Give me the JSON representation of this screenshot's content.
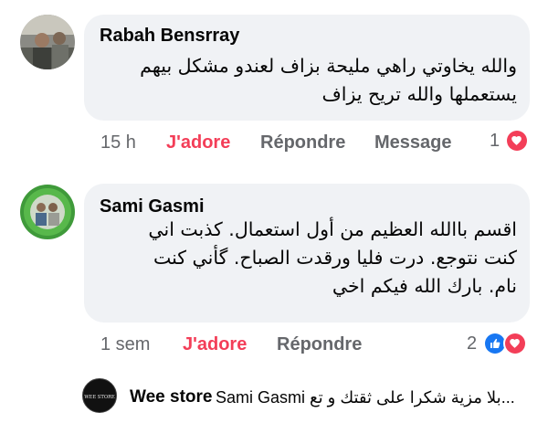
{
  "comments": [
    {
      "author": "Rabah Bensrray",
      "text_lines": [
        "والله يخاوتي راهي مليحة بزاف لعندو مشكل بيهم",
        "يستعملها والله تريح يزاف"
      ],
      "time": "15 h",
      "like_label": "J'adore",
      "reply_label": "Répondre",
      "message_label": "Message",
      "reaction_count": "1",
      "reactions": [
        "love-icon"
      ]
    },
    {
      "author": "Sami Gasmi",
      "text_lines": [
        "اقسم باالله العظيم من أول  استعمال.  كذبت اني",
        "كنت نتوجع. درت فليا ورقدت الصباح. گأني كنت",
        "نام. بارك الله فيكم اخي"
      ],
      "time": "1 sem",
      "like_label": "J'adore",
      "reply_label": "Répondre",
      "reaction_count": "2",
      "reactions": [
        "like-icon",
        "love-icon"
      ]
    }
  ],
  "reply": {
    "page_name": "Wee store",
    "text": "Sami Gasmi بلا مزية شكرا على ثقتك و تع...",
    "avatar_label": "WEE STORE"
  },
  "colors": {
    "bubble": "#f0f2f5",
    "meta": "#65676b",
    "love": "#f33e58",
    "like": "#1877f2"
  }
}
